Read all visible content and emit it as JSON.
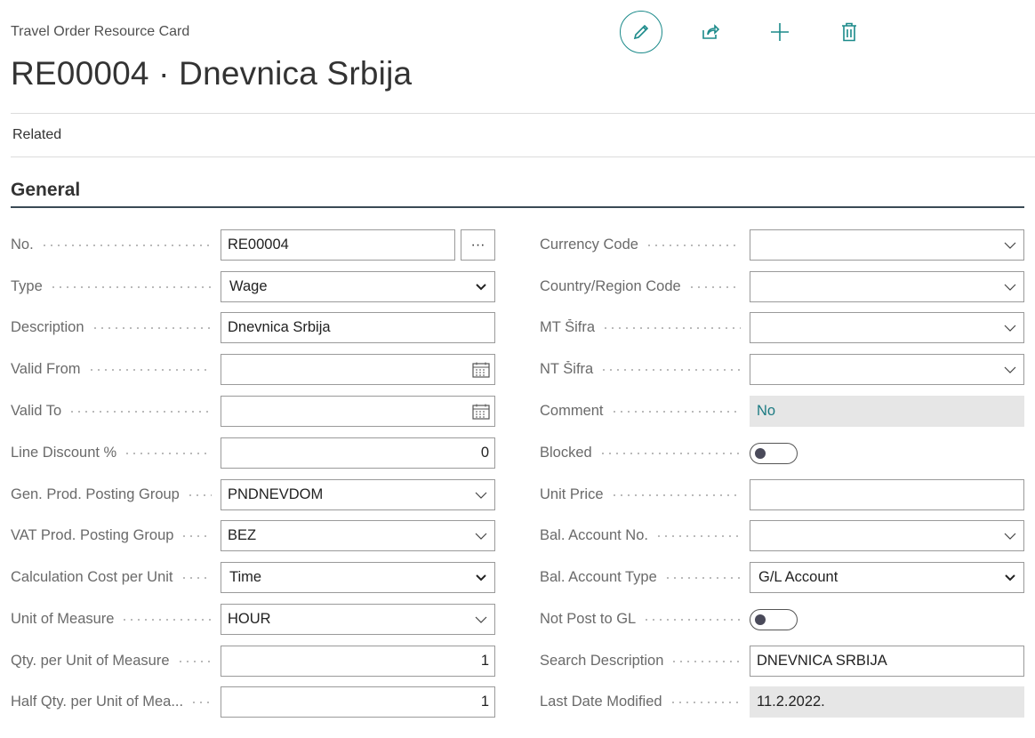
{
  "header": {
    "caption": "Travel Order Resource Card",
    "title": "RE00004 · Dnevnica Srbija",
    "actions": [
      "edit-icon",
      "share-icon",
      "add-icon",
      "delete-icon"
    ]
  },
  "nav": {
    "related": "Related"
  },
  "section": {
    "title": "General"
  },
  "left": [
    {
      "label": "No.",
      "value": "RE00004",
      "more": "···"
    },
    {
      "label": "Type",
      "value": "Wage"
    },
    {
      "label": "Description",
      "value": "Dnevnica Srbija"
    },
    {
      "label": "Valid From",
      "value": ""
    },
    {
      "label": "Valid To",
      "value": ""
    },
    {
      "label": "Line Discount %",
      "value": "0"
    },
    {
      "label": "Gen. Prod. Posting Group",
      "value": "PNDNEVDOM"
    },
    {
      "label": "VAT Prod. Posting Group",
      "value": "BEZ"
    },
    {
      "label": "Calculation Cost per Unit",
      "value": "Time"
    },
    {
      "label": "Unit of Measure",
      "value": "HOUR"
    },
    {
      "label": "Qty. per Unit of Measure",
      "value": "1"
    },
    {
      "label": "Half Qty. per Unit of Mea...",
      "value": "1"
    }
  ],
  "right": [
    {
      "label": "Currency Code",
      "value": ""
    },
    {
      "label": "Country/Region Code",
      "value": ""
    },
    {
      "label": "MT Šifra",
      "value": ""
    },
    {
      "label": "NT Šifra",
      "value": ""
    },
    {
      "label": "Comment",
      "value": "No"
    },
    {
      "label": "Blocked",
      "value": false
    },
    {
      "label": "Unit Price",
      "value": ""
    },
    {
      "label": "Bal. Account No.",
      "value": ""
    },
    {
      "label": "Bal. Account Type",
      "value": "G/L Account"
    },
    {
      "label": "Not Post to GL",
      "value": false
    },
    {
      "label": "Search Description",
      "value": "DNEVNICA SRBIJA"
    },
    {
      "label": "Last Date Modified",
      "value": "11.2.2022."
    }
  ],
  "colors": {
    "accent": "#1b8a8a",
    "heading_rule": "#3a4a55"
  }
}
